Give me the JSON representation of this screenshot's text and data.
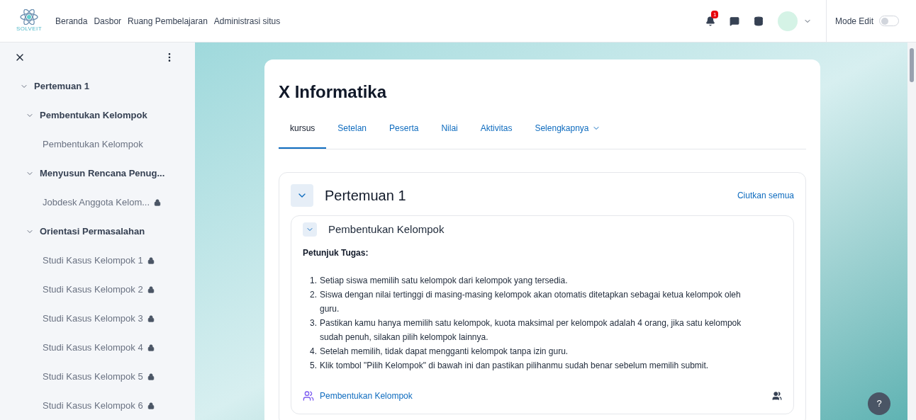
{
  "logo": {
    "text": "SOLVEIT"
  },
  "nav": [
    {
      "label": "Beranda"
    },
    {
      "label": "Dasbor"
    },
    {
      "label": "Ruang Pembelajaran"
    },
    {
      "label": "Administrasi situs"
    }
  ],
  "notifications": {
    "badge": "1"
  },
  "mode_edit": {
    "label": "Mode Edit",
    "on": false
  },
  "sidebar": {
    "items": [
      {
        "label": "Pertemuan 1",
        "expanded": true,
        "children": [
          {
            "label": "Pembentukan Kelompok",
            "expanded": true,
            "children": [
              {
                "label": "Pembentukan Kelompok",
                "locked": false
              }
            ]
          },
          {
            "label": "Menyusun Rencana Penug...",
            "expanded": true,
            "children": [
              {
                "label": "Jobdesk Anggota Kelom...",
                "locked": true
              }
            ]
          },
          {
            "label": "Orientasi Permasalahan",
            "expanded": true,
            "children": [
              {
                "label": "Studi Kasus Kelompok 1",
                "locked": true
              },
              {
                "label": "Studi Kasus Kelompok 2",
                "locked": true
              },
              {
                "label": "Studi Kasus Kelompok 3",
                "locked": true
              },
              {
                "label": "Studi Kasus Kelompok 4",
                "locked": true
              },
              {
                "label": "Studi Kasus Kelompok 5",
                "locked": true
              },
              {
                "label": "Studi Kasus Kelompok 6",
                "locked": true
              }
            ]
          }
        ]
      }
    ]
  },
  "course": {
    "title": "X Informatika",
    "tabs": [
      {
        "label": "kursus",
        "selected": true,
        "dropdown": false
      },
      {
        "label": "Setelan",
        "selected": false,
        "dropdown": false
      },
      {
        "label": "Peserta",
        "selected": false,
        "dropdown": false
      },
      {
        "label": "Nilai",
        "selected": false,
        "dropdown": false
      },
      {
        "label": "Aktivitas",
        "selected": false,
        "dropdown": false
      },
      {
        "label": "Selengkapnya",
        "selected": false,
        "dropdown": true
      }
    ],
    "section": {
      "title": "Pertemuan 1",
      "expanded": true,
      "collapse_all": "Ciutkan semua",
      "subsection": {
        "title": "Pembentukan Kelompok",
        "expanded": true,
        "heading": "Petunjuk Tugas:",
        "steps": [
          {
            "number": "1.",
            "text": "Setiap siswa memilih satu kelompok dari kelompok yang tersedia."
          },
          {
            "number": "2.",
            "text": "Siswa dengan nilai tertinggi di masing-masing kelompok akan otomatis ditetapkan sebagai ketua kelompok oleh guru."
          },
          {
            "number": "3.",
            "text": "Pastikan kamu hanya memilih satu kelompok, kuota maksimal per kelompok adalah 4 orang, jika satu kelompok sudah penuh, silakan pilih kelompok lainnya."
          },
          {
            "number": "4.",
            "text": "Setelah memilih, tidak dapat mengganti kelompok tanpa izin guru."
          },
          {
            "number": "5.",
            "text": "Klik tombol \"Pilih Kelompok\" di bawah ini dan pastikan pilihanmu sudah benar sebelum memilih submit."
          }
        ],
        "activity": {
          "label": "Pembentukan Kelompok"
        }
      }
    }
  },
  "help": {
    "label": "?"
  }
}
